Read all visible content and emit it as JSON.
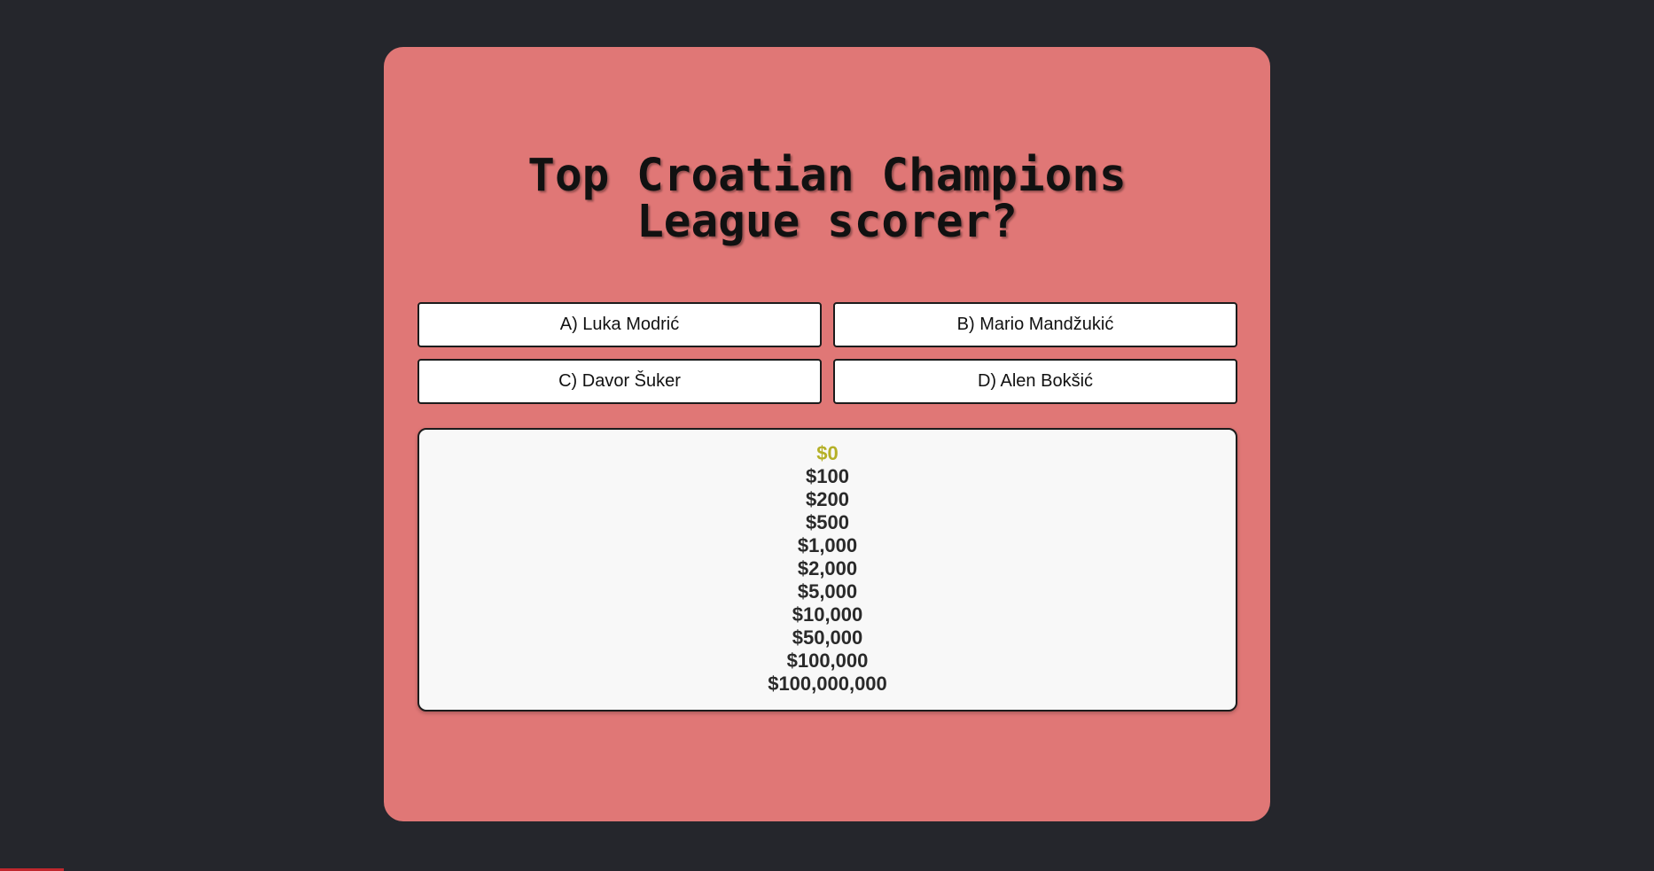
{
  "question": {
    "line1": "Top Croatian Champions",
    "line2": "League scorer?"
  },
  "answers": [
    {
      "label": "A) Luka Modrić"
    },
    {
      "label": "B) Mario Mandžukić"
    },
    {
      "label": "C) Davor Šuker"
    },
    {
      "label": "D) Alen Bokšić"
    }
  ],
  "ladder": {
    "current_index": 0,
    "levels": [
      "$0",
      "$100",
      "$200",
      "$500",
      "$1,000",
      "$2,000",
      "$5,000",
      "$10,000",
      "$50,000",
      "$100,000",
      "$100,000,000"
    ]
  },
  "colors": {
    "background": "#25262c",
    "card": "#e07776",
    "current_level": "#b5b027",
    "corner_mark": "#c0272d"
  }
}
